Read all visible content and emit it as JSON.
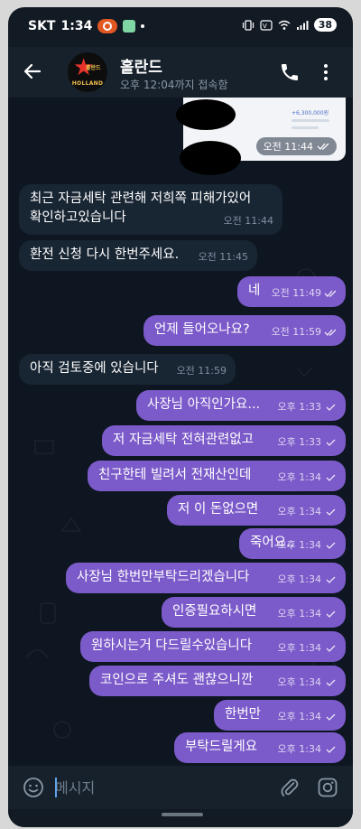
{
  "status_bar": {
    "carrier": "SKT",
    "time": "1:34",
    "battery": "38"
  },
  "header": {
    "title": "홀란드",
    "subtitle": "오후 12:04까지 접속함",
    "avatar": {
      "logo_small": "홀란드",
      "logo_text": "HOLLAND"
    }
  },
  "attached_photo": {
    "amount": "+6,300,000원",
    "time": "오전 11:44"
  },
  "messages": [
    {
      "direction": "in",
      "text": "최근 자금세탁 관련해 저희쪽 피해가있어\n확인하고있습니다",
      "time": "오전 11:44"
    },
    {
      "direction": "in",
      "text": "환전 신청 다시 한번주세요.",
      "time": "오전 11:45"
    },
    {
      "direction": "out",
      "text": "네",
      "time": "오전 11:49",
      "status": "read"
    },
    {
      "direction": "out",
      "text": "언제 들어오나요?",
      "time": "오전 11:59",
      "status": "read"
    },
    {
      "direction": "in",
      "text": "아직 검토중에 있습니다",
      "time": "오전 11:59"
    },
    {
      "direction": "out",
      "text": "사장님 아직인가요...",
      "time": "오후 1:33",
      "status": "sent"
    },
    {
      "direction": "out",
      "text": "저 자금세탁 전혀관련없고",
      "time": "오후 1:33",
      "status": "sent"
    },
    {
      "direction": "out",
      "text": "친구한테 빌려서 전재산인데",
      "time": "오후 1:34",
      "status": "sent"
    },
    {
      "direction": "out",
      "text": "저 이 돈없으면",
      "time": "오후 1:34",
      "status": "sent"
    },
    {
      "direction": "out",
      "text": "죽어요..",
      "time": "오후 1:34",
      "status": "sent"
    },
    {
      "direction": "out",
      "text": "사장님 한번만부탁드리겠습니다",
      "time": "오후 1:34",
      "status": "sent"
    },
    {
      "direction": "out",
      "text": "인증필요하시면",
      "time": "오후 1:34",
      "status": "sent"
    },
    {
      "direction": "out",
      "text": "원하시는거 다드릴수있습니다",
      "time": "오후 1:34",
      "status": "sent"
    },
    {
      "direction": "out",
      "text": "코인으로 주셔도 괜찮으니깐",
      "time": "오후 1:34",
      "status": "sent"
    },
    {
      "direction": "out",
      "text": "한번만",
      "time": "오후 1:34",
      "status": "sent"
    },
    {
      "direction": "out",
      "text": "부탁드릴게요",
      "time": "오후 1:34",
      "status": "sent"
    }
  ],
  "composer": {
    "placeholder": "메시지"
  },
  "icons": {
    "back": "back-arrow-icon",
    "call": "phone-icon",
    "more": "more-vertical-icon",
    "emoji": "emoji-icon",
    "attach": "paperclip-icon",
    "camera": "instagram-camera-icon",
    "read": "double-check-icon",
    "sent": "single-check-icon"
  },
  "colors": {
    "outgoing_bubble": "#7b5ac9",
    "incoming_bubble": "#182533",
    "chat_background": "#0e1621",
    "header_background": "#17212b"
  }
}
